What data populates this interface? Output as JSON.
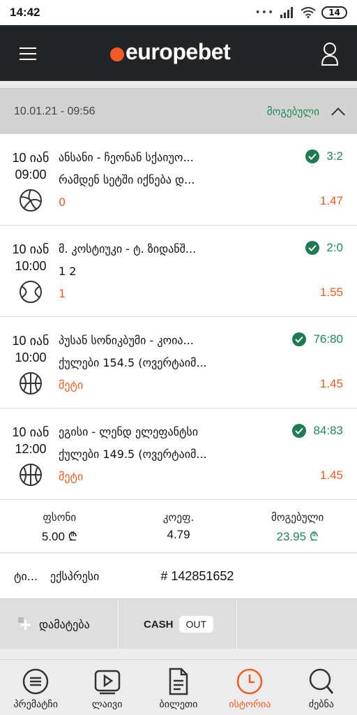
{
  "status_bar": {
    "time": "14:42",
    "signal_dots": "•••",
    "battery": "14"
  },
  "header": {
    "brand": "europebet"
  },
  "bet": {
    "datetime": "10.01.21 - 09:56",
    "status": "მოგებული",
    "events": [
      {
        "date": "10 იან",
        "time": "09:00",
        "sport": "volleyball-icon",
        "teams": "ანსანი - ჩეონან სქაიუო...",
        "market": "რამდენ სეტში იქნება დ...",
        "pick": "0",
        "score": "3:2",
        "odds": "1.47"
      },
      {
        "date": "10 იან",
        "time": "10:00",
        "sport": "tennis-ball-icon",
        "teams": "მ. კოსტიუკი - ტ. ზიდანშ...",
        "market": "1 2",
        "pick": "1",
        "score": "2:0",
        "odds": "1.55"
      },
      {
        "date": "10 იან",
        "time": "10:00",
        "sport": "basketball-icon",
        "teams": "პუსან სონიკბუმი - კოია...",
        "market": "ქულები 154.5 (ოვერტაიმ...",
        "pick": "მეტი",
        "score": "76:80",
        "odds": "1.45"
      },
      {
        "date": "10 იან",
        "time": "12:00",
        "sport": "basketball-icon",
        "teams": "ეგისი - ლენდ ელეფანტსი",
        "market": "ქულები 149.5 (ოვერტაიმ...",
        "pick": "მეტი",
        "score": "84:83",
        "odds": "1.45"
      }
    ],
    "summary": {
      "stake_label": "ფსონი",
      "stake_value": "5.00 ₾",
      "odds_label": "კოეფ.",
      "odds_value": "4.79",
      "win_label": "მოგებული",
      "win_value": "23.95 ₾"
    },
    "type_short": "ტი...",
    "type": "ექსპრესი",
    "bet_id": "# 142851652"
  },
  "actions": {
    "add_label": "დამატება",
    "cash_label": "CASH",
    "out_label": "OUT"
  },
  "bottom_nav": [
    {
      "label": "პრემატჩი",
      "icon": "list-circle-icon"
    },
    {
      "label": "ლაივი",
      "icon": "play-icon"
    },
    {
      "label": "ბილეთი",
      "icon": "ticket-document-icon"
    },
    {
      "label": "ისტორია",
      "icon": "clock-icon",
      "active": true
    },
    {
      "label": "ძებნა",
      "icon": "search-icon"
    }
  ],
  "colors": {
    "accent": "#f15a22",
    "win": "#1d8a5a",
    "header": "#222425"
  }
}
